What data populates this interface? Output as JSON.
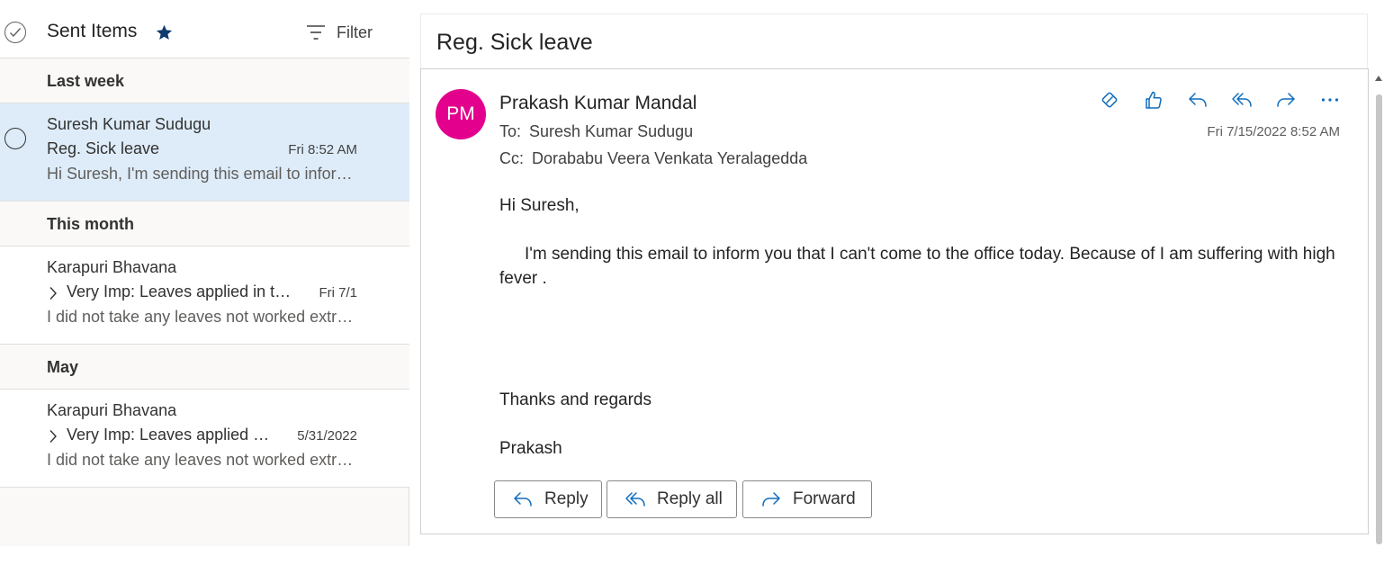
{
  "list": {
    "folder_title": "Sent Items",
    "filter_label": "Filter",
    "groups": [
      {
        "label": "Last week",
        "messages": [
          {
            "sender": "Suresh Kumar Sudugu",
            "subject": "Reg. Sick leave",
            "date": "Fri 8:52 AM",
            "preview": "Hi Suresh, I'm sending this email to inform you that I can't come to the office today."
          }
        ]
      },
      {
        "label": "This month",
        "messages": [
          {
            "sender": "Karapuri Bhavana",
            "subject": "Very Imp: Leaves applied in the portal",
            "date": "Fri 7/1",
            "preview": "I did not take any leaves not worked extra hours"
          }
        ]
      },
      {
        "label": "May",
        "messages": [
          {
            "sender": "Karapuri Bhavana",
            "subject": "Very Imp: Leaves applied in the portal",
            "date": "5/31/2022",
            "preview": "I did not take any leaves not worked extra hours"
          }
        ]
      }
    ]
  },
  "reading": {
    "subject": "Reg. Sick leave",
    "avatar_initials": "PM",
    "from": "Prakash Kumar Mandal",
    "to_label": "To:",
    "to": "Suresh Kumar Sudugu",
    "cc_label": "Cc:",
    "cc": "Dorababu Veera Venkata Yeralagedda",
    "sent_date": "Fri 7/15/2022 8:52 AM",
    "body": {
      "greeting": "Hi Suresh,",
      "paragraph": "I'm sending this email to inform you that I can't come to the office today. Because of I am suffering with high fever .",
      "closing": "Thanks and regards",
      "signature": "Prakash"
    },
    "buttons": {
      "reply": "Reply",
      "reply_all": "Reply all",
      "forward": "Forward"
    }
  },
  "icons": {
    "action_bar": [
      "immersive-reader-icon",
      "like-icon",
      "reply-icon",
      "reply-all-icon",
      "forward-icon",
      "more-actions-icon"
    ]
  },
  "colors": {
    "accent": "#0f6cbd",
    "avatar": "#e3008c",
    "selected_row": "#deecf9",
    "star": "#0f3a6e"
  }
}
